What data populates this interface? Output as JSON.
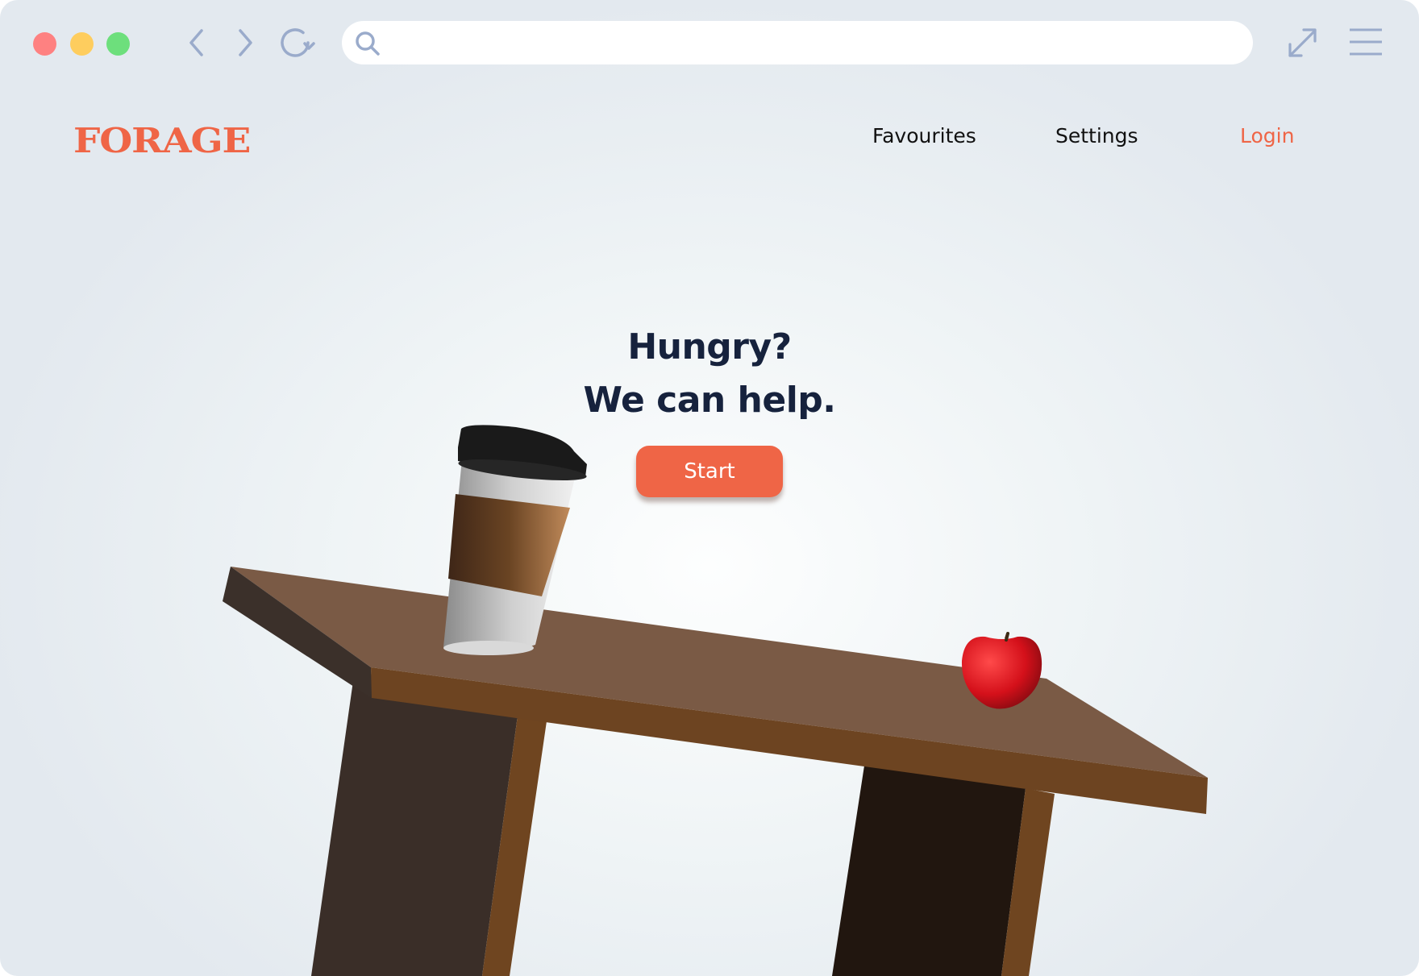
{
  "browser": {
    "address_value": "",
    "traffic_lights": [
      "#fe8181",
      "#fecd5e",
      "#6ddf7c"
    ],
    "icon_color": "#9aabcb"
  },
  "site": {
    "logo": "FORAGE",
    "nav": {
      "favourites": "Favourites",
      "settings": "Settings",
      "login": "Login"
    },
    "accent_color": "#ef6546"
  },
  "hero": {
    "title_line1": "Hungry?",
    "title_line2": "We can help.",
    "start_label": "Start"
  },
  "scene": {
    "objects": [
      "coffee-cup",
      "apple",
      "wooden-table"
    ]
  }
}
